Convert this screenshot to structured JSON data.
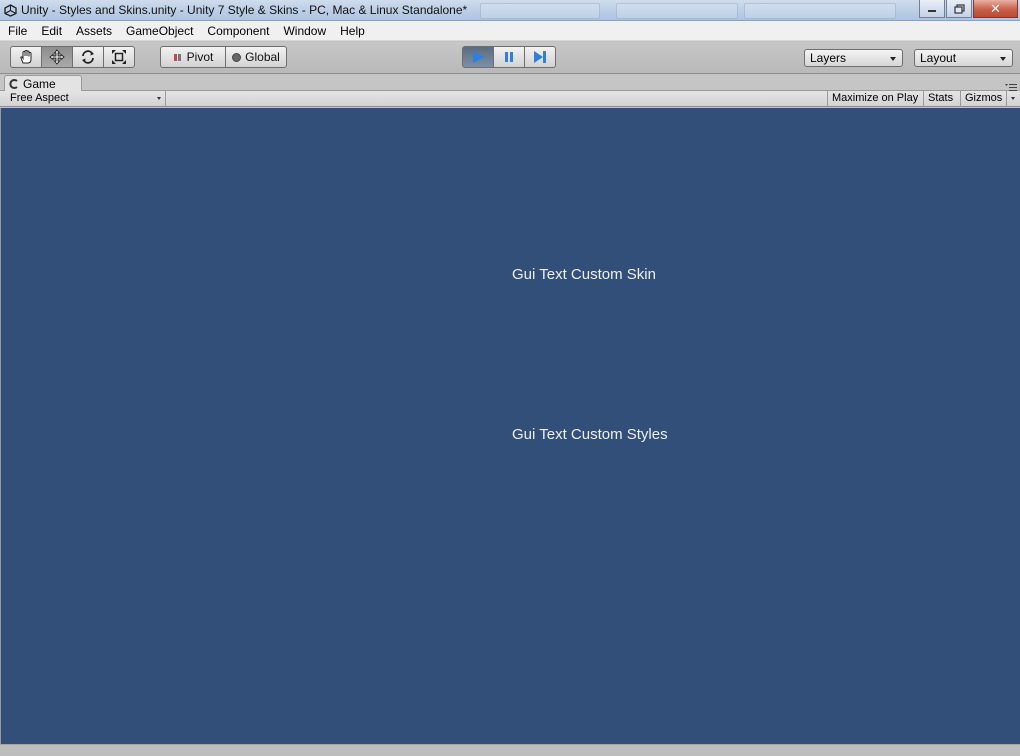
{
  "window": {
    "title": "Unity - Styles and Skins.unity - Unity 7 Style & Skins - PC, Mac & Linux Standalone*",
    "close_label": "✕"
  },
  "menu": {
    "items": [
      "File",
      "Edit",
      "Assets",
      "GameObject",
      "Component",
      "Window",
      "Help"
    ]
  },
  "toolbar": {
    "pivot_label": "Pivot",
    "global_label": "Global",
    "layers_label": "Layers",
    "layout_label": "Layout",
    "active_tool": "move",
    "play_state": "playing"
  },
  "game_tab": {
    "label": "Game",
    "aspect": "Free Aspect",
    "maximize_label": "Maximize on Play",
    "stats_label": "Stats",
    "gizmos_label": "Gizmos"
  },
  "game_view": {
    "background": "#324f79",
    "label_skin": "Gui Text Custom Skin",
    "label_styles": "Gui Text Custom Styles"
  },
  "colors": {
    "play_accent": "#2f7fe0"
  }
}
